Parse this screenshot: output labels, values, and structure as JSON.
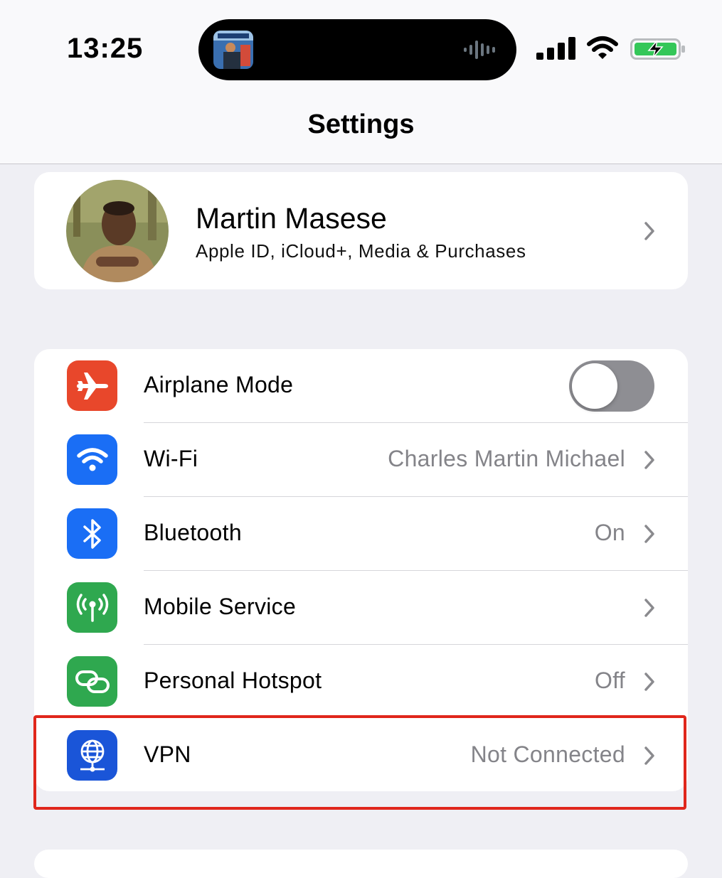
{
  "status_bar": {
    "time": "13:25",
    "icons": [
      "album-art-icon",
      "audio-waveform-icon",
      "cellular-signal-icon",
      "wifi-icon",
      "battery-charging-icon"
    ],
    "battery_color": "#34c759"
  },
  "nav": {
    "title": "Settings"
  },
  "profile": {
    "name": "Martin Masese",
    "subtitle": "Apple ID, iCloud+, Media & Purchases"
  },
  "settings": [
    {
      "label": "Airplane Mode",
      "value": "",
      "icon": "airplane-icon",
      "color": "#e8472b",
      "control": "toggle",
      "toggle_on": false
    },
    {
      "label": "Wi-Fi",
      "value": "Charles Martin Michael",
      "icon": "wifi-icon",
      "color": "#1a6ef5",
      "control": "chevron"
    },
    {
      "label": "Bluetooth",
      "value": "On",
      "icon": "bluetooth-icon",
      "color": "#1a6ef5",
      "control": "chevron"
    },
    {
      "label": "Mobile Service",
      "value": "",
      "icon": "antenna-icon",
      "color": "#2fa84f",
      "control": "chevron"
    },
    {
      "label": "Personal Hotspot",
      "value": "Off",
      "icon": "hotspot-link-icon",
      "color": "#2fa84f",
      "control": "chevron"
    },
    {
      "label": "VPN",
      "value": "Not Connected",
      "icon": "vpn-globe-icon",
      "color": "#1a55d8",
      "control": "chevron"
    }
  ],
  "highlight_color": "#e0261b"
}
